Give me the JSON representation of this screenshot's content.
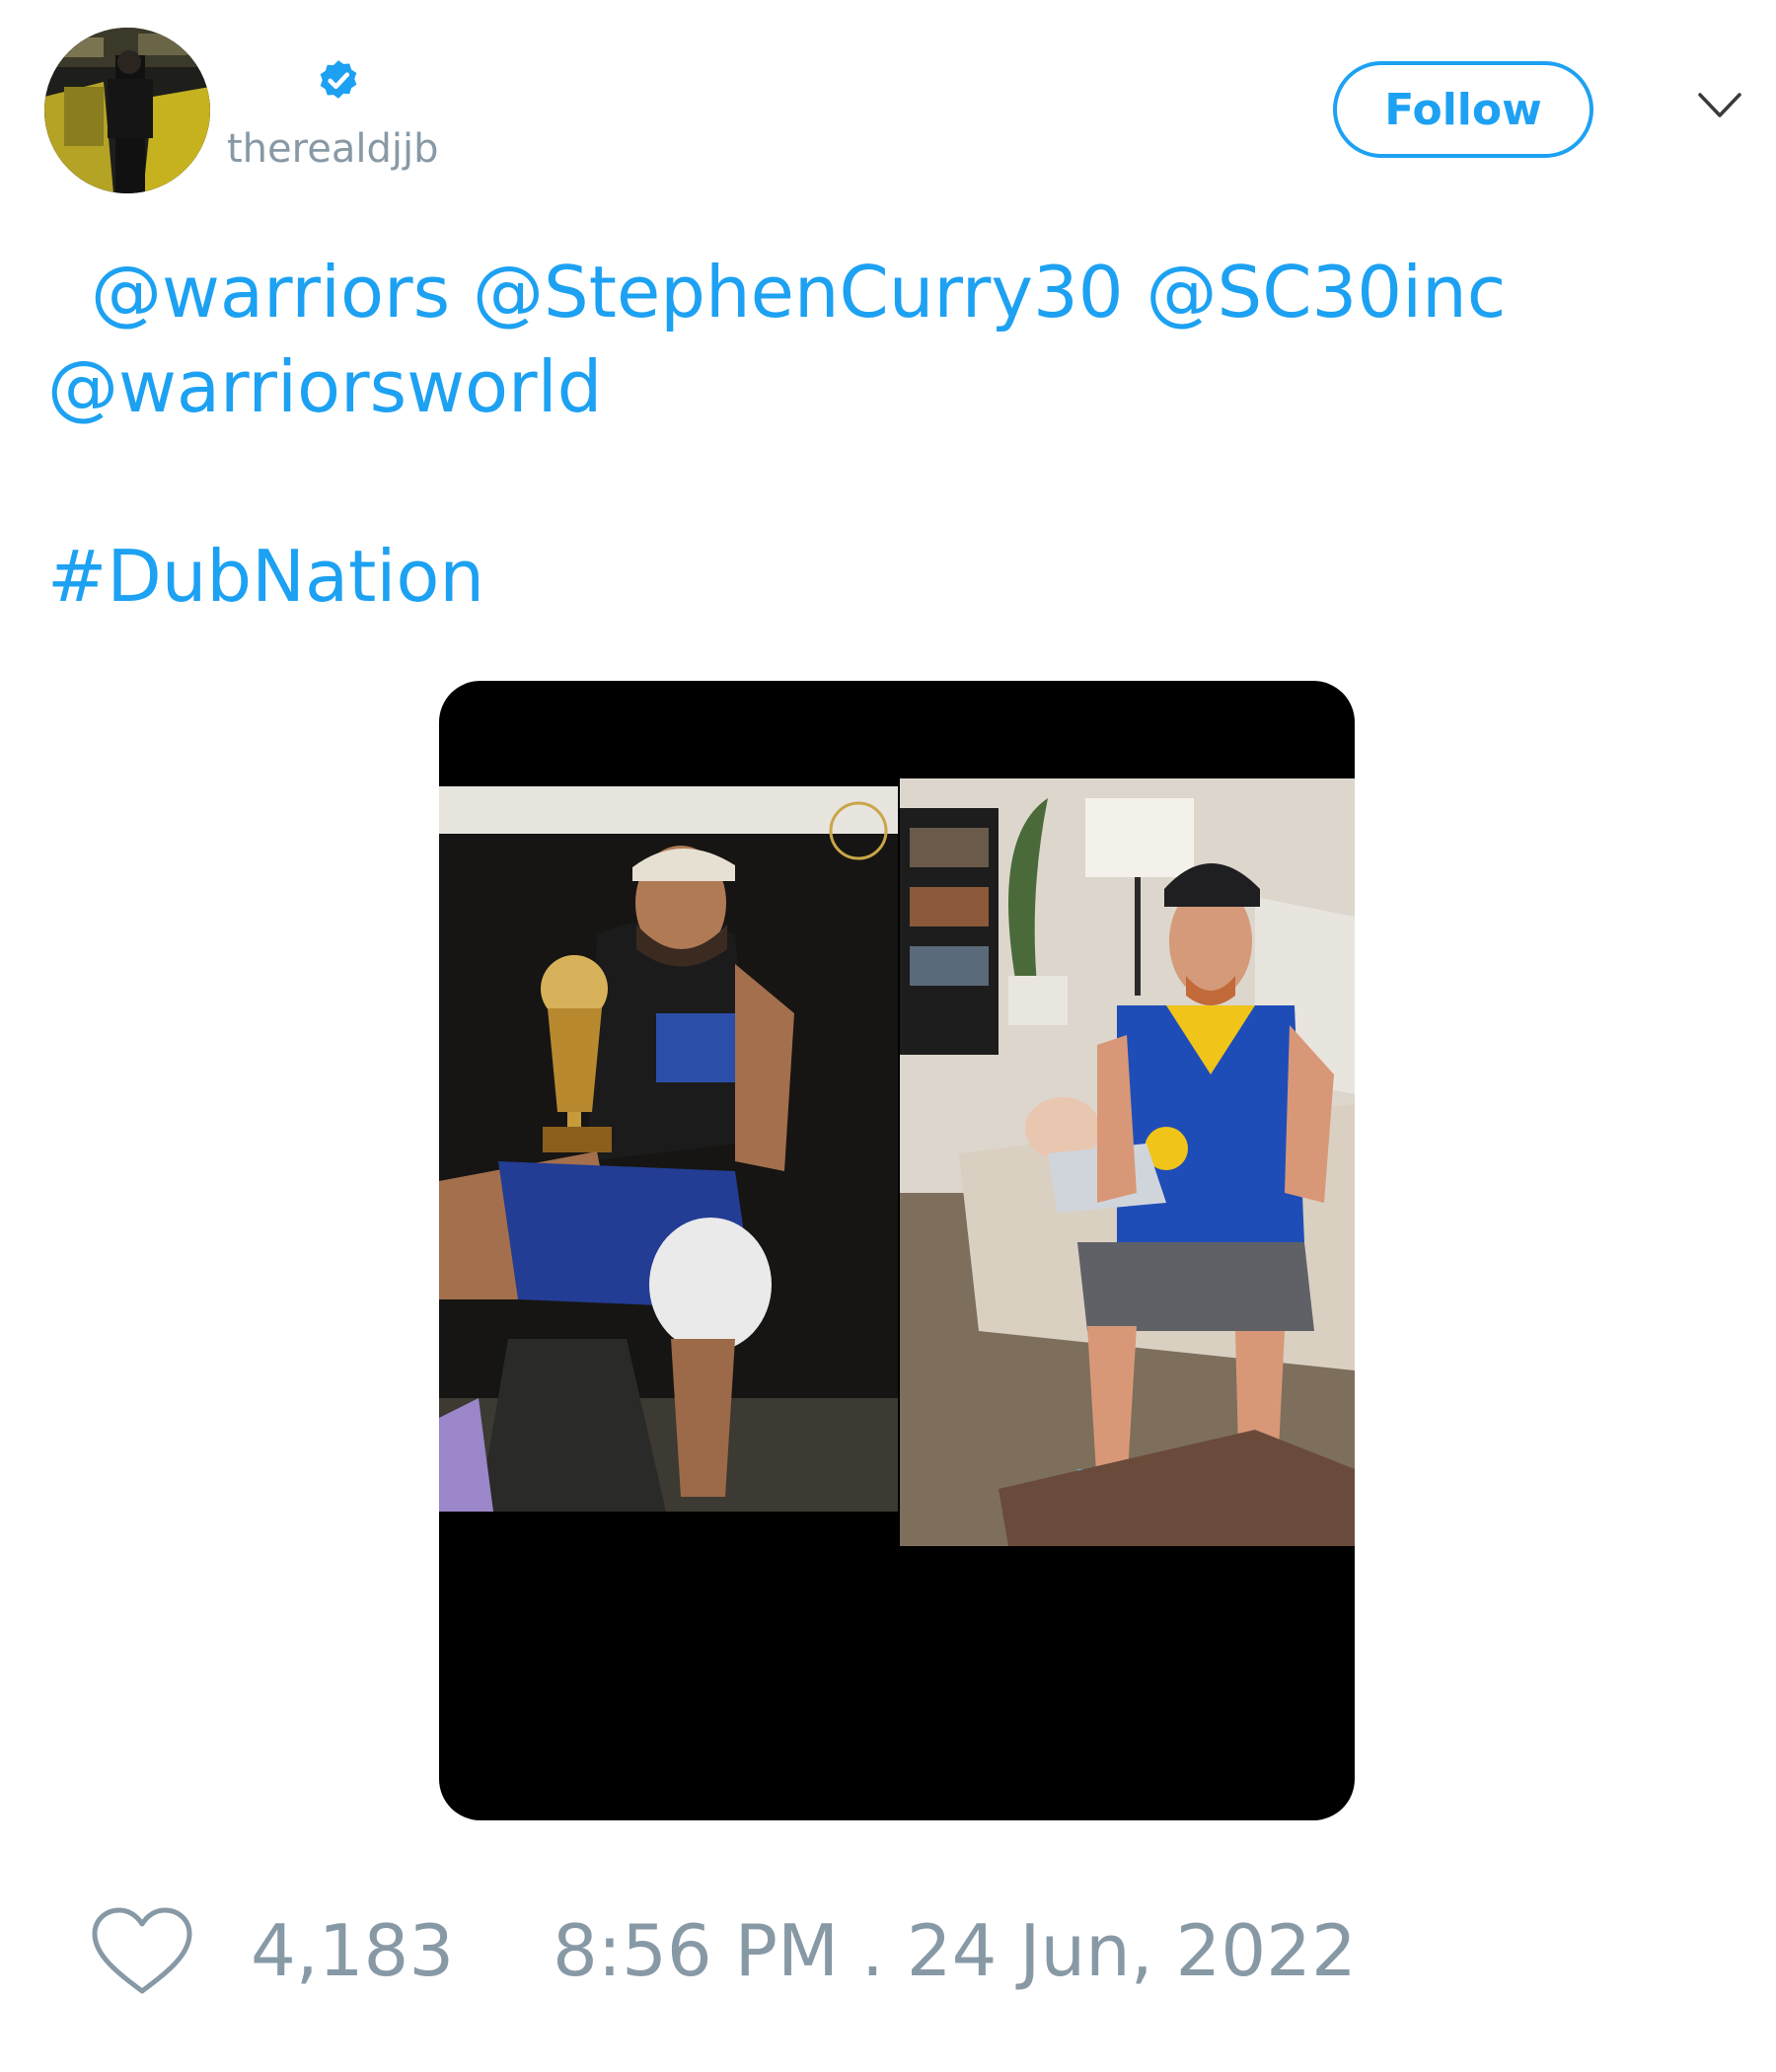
{
  "author": {
    "handle": "therealdjjb",
    "verified": true,
    "avatar_icon": "profile-photo"
  },
  "follow_button": {
    "label": "Follow"
  },
  "menu": {
    "icon": "chevron-down-icon"
  },
  "tweet": {
    "mentions_line1": [
      "@warriors",
      "@StephenCurry30",
      "@SC30inc"
    ],
    "mentions_line2": [
      "@warriorsworld"
    ],
    "hashtag": "#DubNation"
  },
  "media": {
    "type": "photo-collage",
    "panels": 2
  },
  "footer": {
    "like_icon": "heart-outline-icon",
    "likes": "4,183",
    "timestamp": "8:56 PM . 24 Jun, 2022"
  },
  "colors": {
    "accent": "#1da1f2",
    "muted": "#8899a6",
    "media_background": "#000000"
  }
}
